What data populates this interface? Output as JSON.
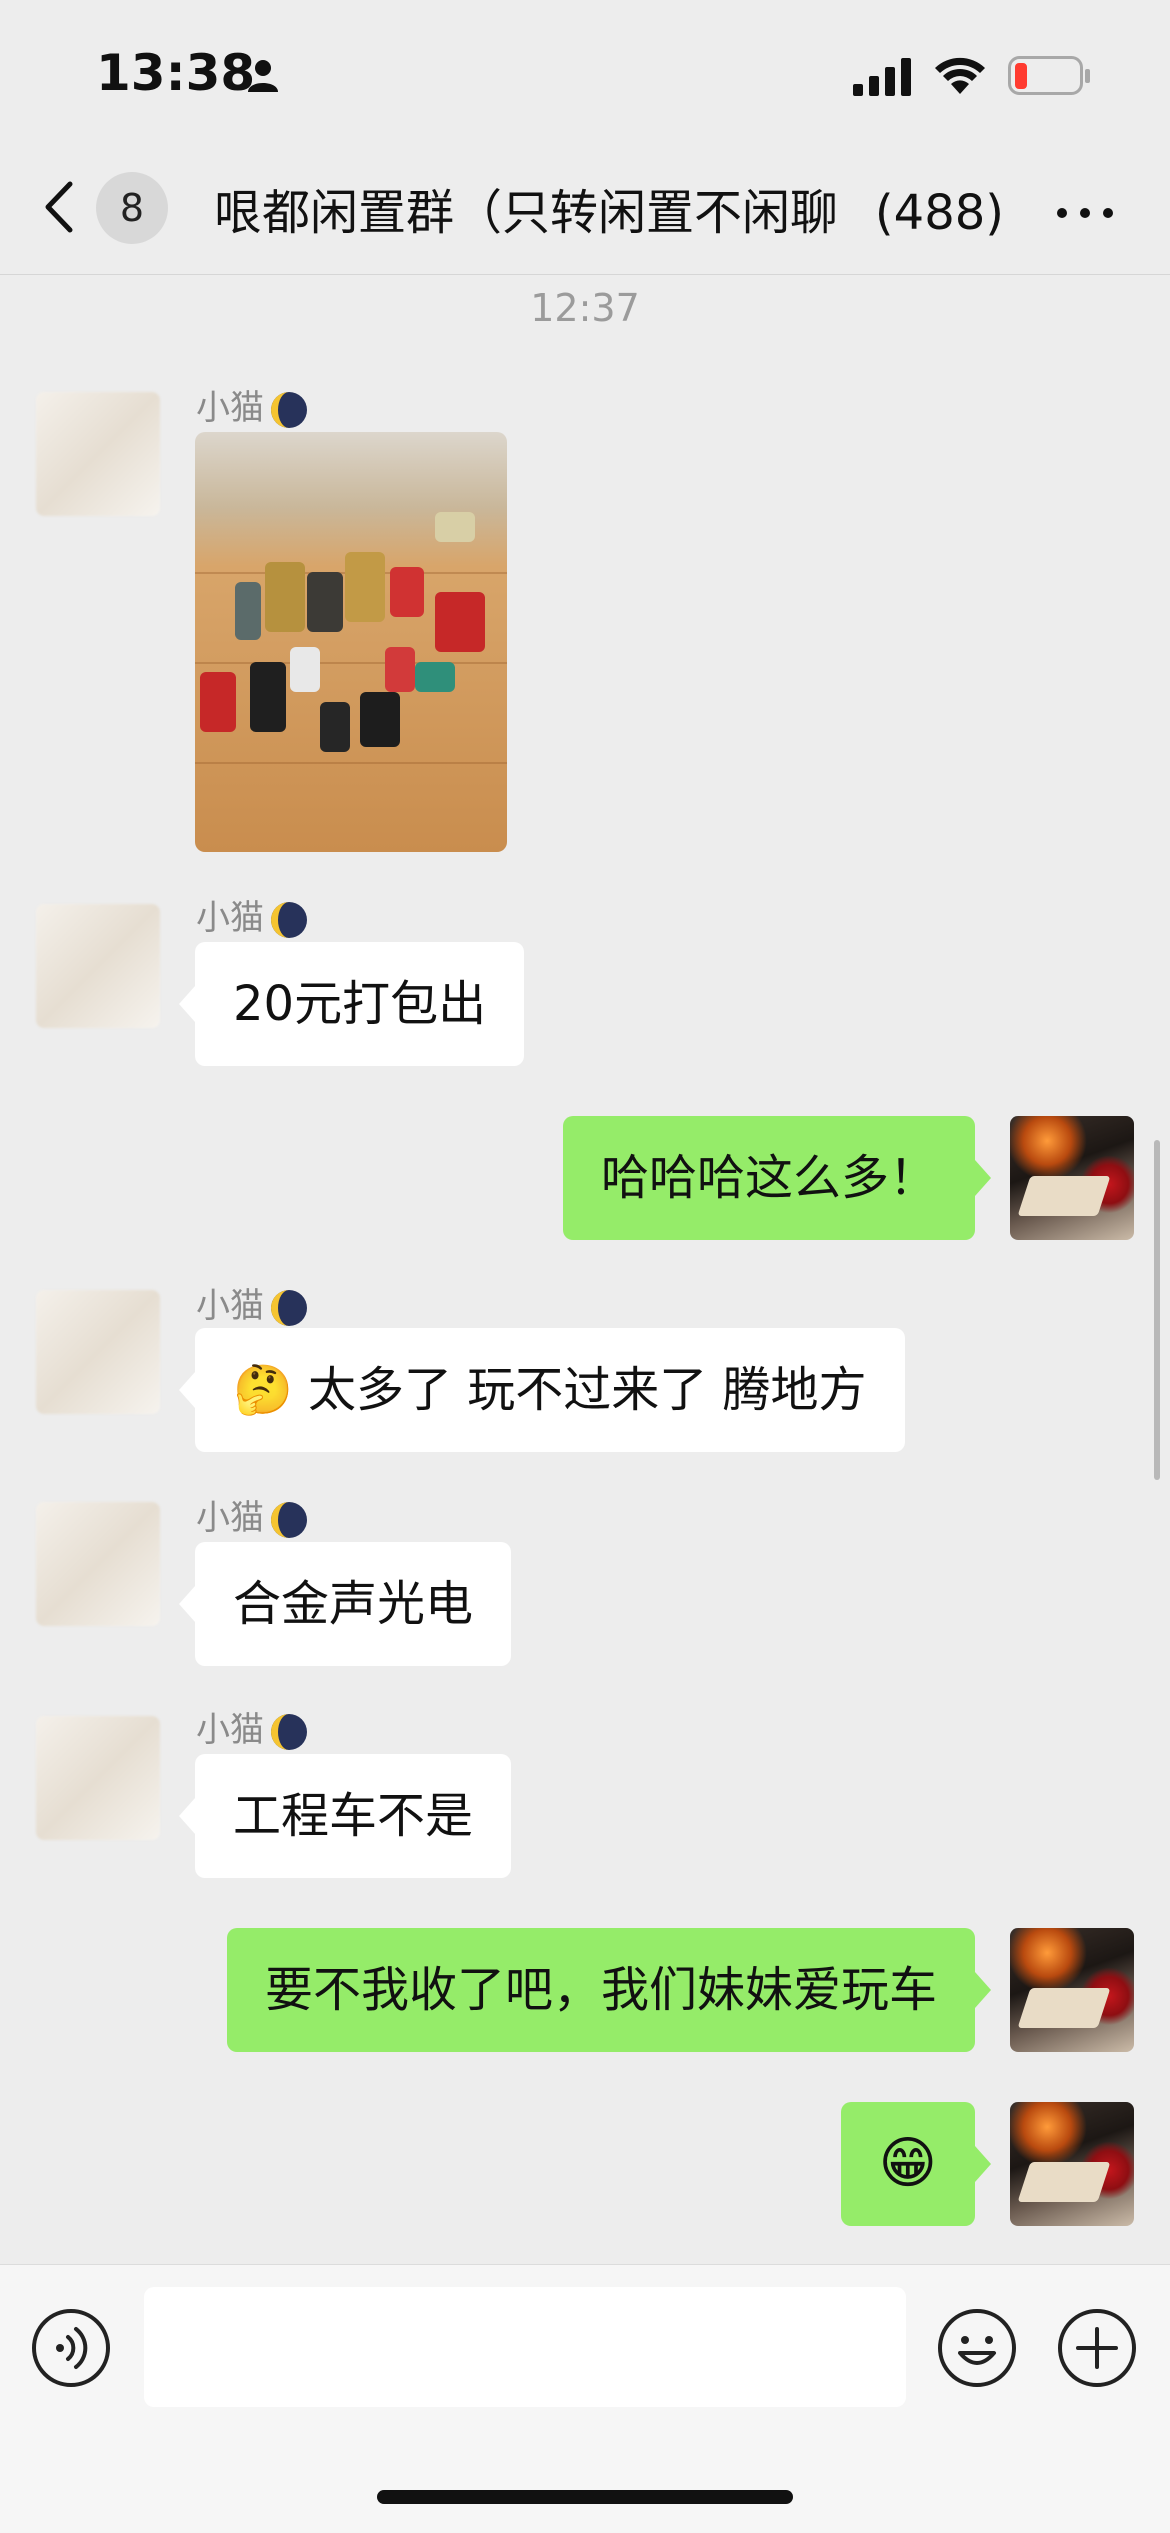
{
  "status_bar": {
    "time": "13:38"
  },
  "nav": {
    "unread_count": "8",
    "title": "哏都闲置群（只转闲置不闲聊",
    "member_count": "(488)"
  },
  "chat": {
    "timestamp": "12:37",
    "messages": [
      {
        "side": "left",
        "sender": "小猫",
        "type": "image",
        "content": ""
      },
      {
        "side": "left",
        "sender": "小猫",
        "type": "text",
        "content": "20元打包出"
      },
      {
        "side": "right",
        "sender": "",
        "type": "text",
        "content": "哈哈哈这么多！"
      },
      {
        "side": "left",
        "sender": "小猫",
        "type": "text",
        "emoji": "🤔",
        "content": "太多了 玩不过来了 腾地方"
      },
      {
        "side": "left",
        "sender": "小猫",
        "type": "text",
        "content": "合金声光电"
      },
      {
        "side": "left",
        "sender": "小猫",
        "type": "text",
        "content": "工程车不是"
      },
      {
        "side": "right",
        "sender": "",
        "type": "text",
        "content": "要不我收了吧，我们妹妹爱玩车"
      },
      {
        "side": "right",
        "sender": "",
        "type": "emoji",
        "content": "😁"
      }
    ]
  },
  "input": {
    "placeholder": ""
  },
  "colors": {
    "self_bubble": "#95ec69",
    "other_bubble": "#ffffff",
    "background": "#ededed"
  }
}
